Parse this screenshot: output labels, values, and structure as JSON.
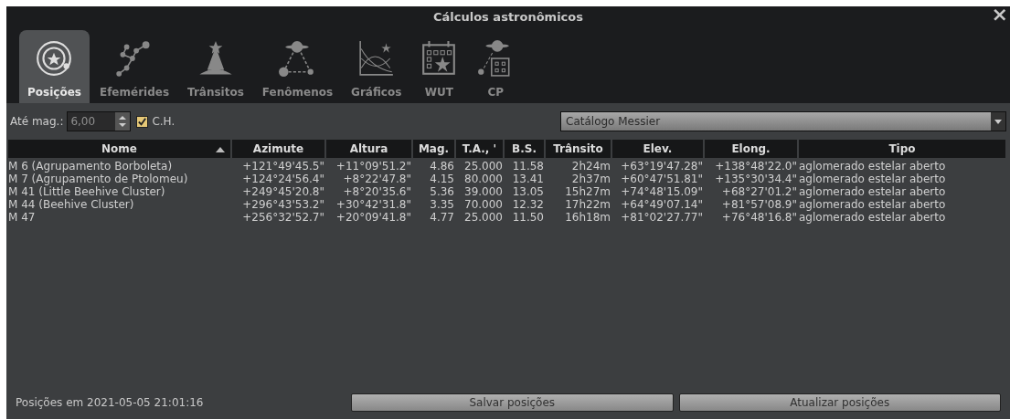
{
  "window": {
    "title": "Cálculos astronômicos",
    "close": "×"
  },
  "tabs": [
    {
      "label": "Posições",
      "selected": true
    },
    {
      "label": "Efemérides",
      "selected": false
    },
    {
      "label": "Trânsitos",
      "selected": false
    },
    {
      "label": "Fenômenos",
      "selected": false
    },
    {
      "label": "Gráficos",
      "selected": false
    },
    {
      "label": "WUT",
      "selected": false
    },
    {
      "label": "CP",
      "selected": false
    }
  ],
  "toolbar": {
    "magnitude_label": "Até mag.:",
    "magnitude_value": "6,00",
    "ch_checkbox": {
      "label": "C.H.",
      "checked": true
    },
    "catalog_dropdown": "Catálogo Messier"
  },
  "table": {
    "columns": [
      {
        "label": "Nome",
        "sorted": true
      },
      {
        "label": "Azimute",
        "sorted": false
      },
      {
        "label": "Altura",
        "sorted": false
      },
      {
        "label": "Mag.",
        "sorted": false
      },
      {
        "label": "T.A., '",
        "sorted": false
      },
      {
        "label": "B.S.",
        "sorted": false
      },
      {
        "label": "Trânsito",
        "sorted": false
      },
      {
        "label": "Elev.",
        "sorted": false
      },
      {
        "label": "Elong.",
        "sorted": false
      },
      {
        "label": "Tipo",
        "sorted": false
      }
    ],
    "rows": [
      [
        "M 6 (Agrupamento Borboleta)",
        "+121°49'45.5\"",
        "+11°09'51.2\"",
        "4.86",
        "25.000",
        "11.58",
        "2h24m",
        "+63°19'47.28\"",
        "+138°48'22.0\"",
        "aglomerado estelar aberto"
      ],
      [
        "M 7 (Agrupamento de Ptolomeu)",
        "+124°24'56.4\"",
        "+8°22'47.8\"",
        "4.15",
        "80.000",
        "13.41",
        "2h37m",
        "+60°47'51.81\"",
        "+135°30'34.4\"",
        "aglomerado estelar aberto"
      ],
      [
        "M 41 (Little Beehive Cluster)",
        "+249°45'20.8\"",
        "+8°20'35.6\"",
        "5.36",
        "39.000",
        "13.05",
        "15h27m",
        "+74°48'15.09\"",
        "+68°27'01.2\"",
        "aglomerado estelar aberto"
      ],
      [
        "M 44 (Beehive Cluster)",
        "+296°43'53.2\"",
        "+30°42'31.8\"",
        "3.35",
        "70.000",
        "12.32",
        "17h22m",
        "+64°49'07.14\"",
        "+81°57'08.9\"",
        "aglomerado estelar aberto"
      ],
      [
        "M 47",
        "+256°32'52.7\"",
        "+20°09'41.8\"",
        "4.77",
        "25.000",
        "11.50",
        "16h18m",
        "+81°02'27.77\"",
        "+76°48'16.8\"",
        "aglomerado estelar aberto"
      ]
    ]
  },
  "footer": {
    "status": "Posições em 2021-05-05 21:01:16",
    "buttons": [
      "Salvar posições",
      "Atualizar posições"
    ]
  }
}
